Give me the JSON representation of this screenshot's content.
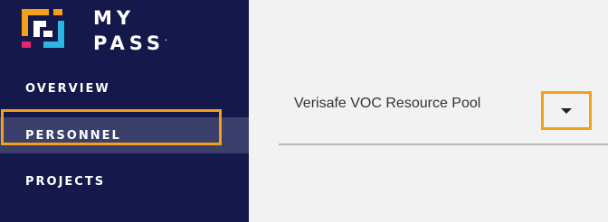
{
  "brand": {
    "line1": "MY",
    "line2": "PASS",
    "trademark": "·"
  },
  "sidebar": {
    "items": [
      {
        "label": "OVERVIEW",
        "active": false
      },
      {
        "label": "PERSONNEL",
        "active": true
      },
      {
        "label": "PROJECTS",
        "active": false
      }
    ]
  },
  "main": {
    "resource_pool": {
      "selected": "Verisafe VOC Resource Pool",
      "icon": "caret-down-icon"
    }
  },
  "colors": {
    "sidebar_bg": "#14184a",
    "active_item_bg": "#3a3f6b",
    "highlight": "#f5a01a",
    "logo_orange": "#f5a01a",
    "logo_cyan": "#2ab7e6",
    "logo_pink": "#e8246e"
  }
}
